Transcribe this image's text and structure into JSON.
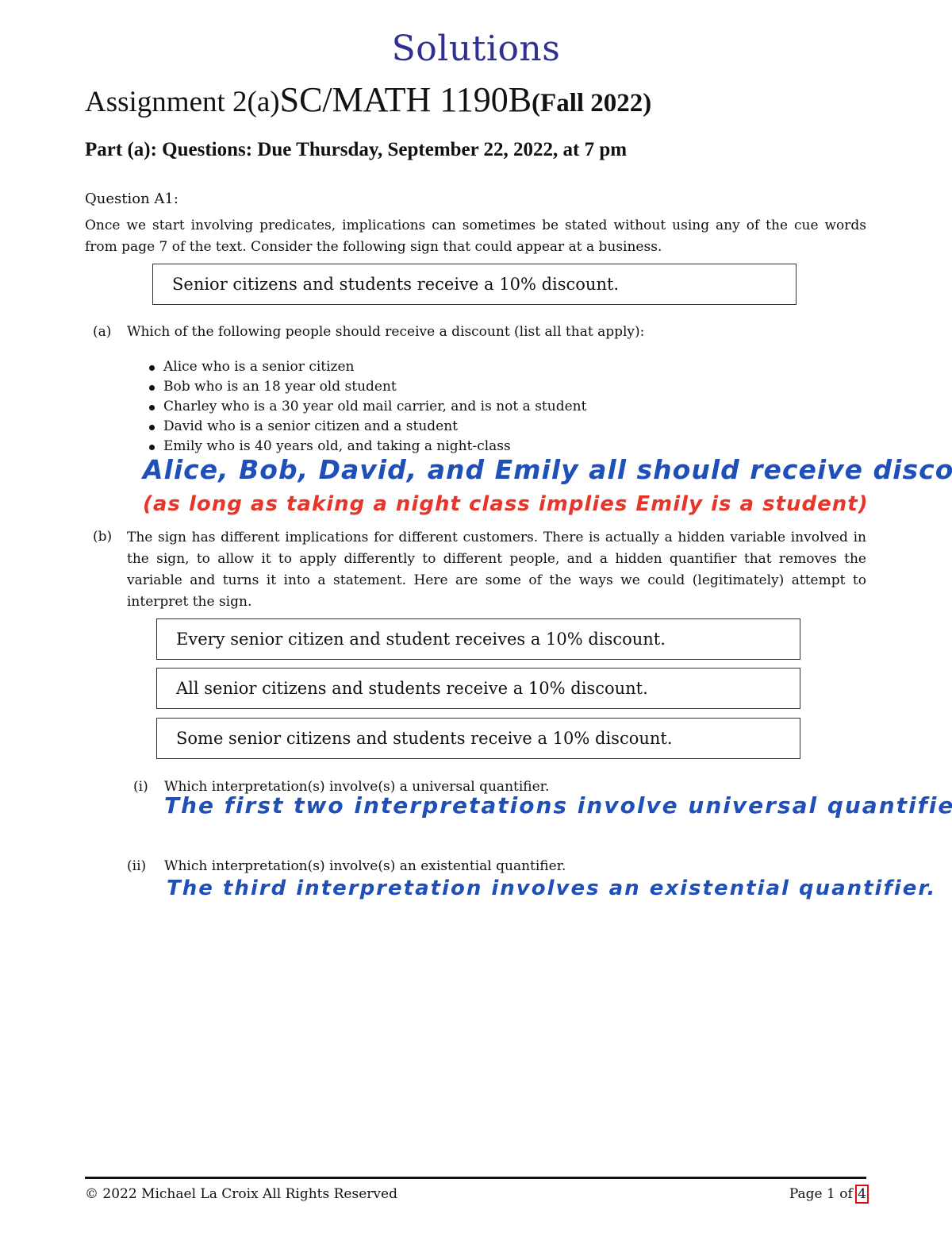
{
  "header": {
    "solutions_label": "Solutions",
    "title_part1": "Assignment 2(a)",
    "title_part2": "SC/MATH 1190B",
    "title_part3": "(Fall 2022)",
    "part_heading": "Part (a): Questions: Due Thursday, September 22, 2022, at 7 pm"
  },
  "question": {
    "heading": "Question A1:",
    "intro": "Once we start involving predicates, implications can sometimes be stated without using any of the cue words from page 7 of the text. Consider the following sign that could appear at a business.",
    "sign_text": "Senior citizens and students receive a 10% discount.",
    "part_a": {
      "label": "(a)",
      "text": "Which of the following people should receive a discount (list all that apply):",
      "people": [
        "Alice who is a senior citizen",
        "Bob who is an 18 year old student",
        "Charley who is a 30 year old mail carrier, and is not a student",
        "David who is a senior citizen and a student",
        "Emily who is 40 years old, and taking a night-class"
      ],
      "answer_line1": "Alice, Bob, David, and Emily all should receive discounts,",
      "answer_line2": "(as long as taking a night class implies Emily is a student)"
    },
    "part_b": {
      "label": "(b)",
      "text": "The sign has different implications for different customers.  There is actually a hidden variable involved in the sign, to allow it to apply differently to different people, and a hidden quantifier that removes the variable and turns it into a statement. Here are some of the ways we could (legitimately) attempt to interpret the sign.",
      "interpretations": [
        "Every senior citizen and student receives a 10% discount.",
        "All senior citizens and students receive a 10% discount.",
        "Some senior citizens and students receive a 10% discount."
      ],
      "sub_i": {
        "label": "(i)",
        "text": "Which interpretation(s) involve(s) a universal quantifier.",
        "answer": "The first two interpretations involve universal quantifiers"
      },
      "sub_ii": {
        "label": "(ii)",
        "text": "Which interpretation(s) involve(s) an existential quantifier.",
        "answer": "The third interpretation involves an existential quantifier."
      }
    }
  },
  "footer": {
    "copyright": "© 2022 Michael La Croix All Rights Reserved",
    "page_prefix": "Page 1 of ",
    "page_total": "4"
  },
  "colors": {
    "solutions_title": "#2e3192",
    "handwriting_blue": "#1f4fb8",
    "handwriting_red": "#e8352a",
    "page_total_highlight": "#e01010"
  }
}
